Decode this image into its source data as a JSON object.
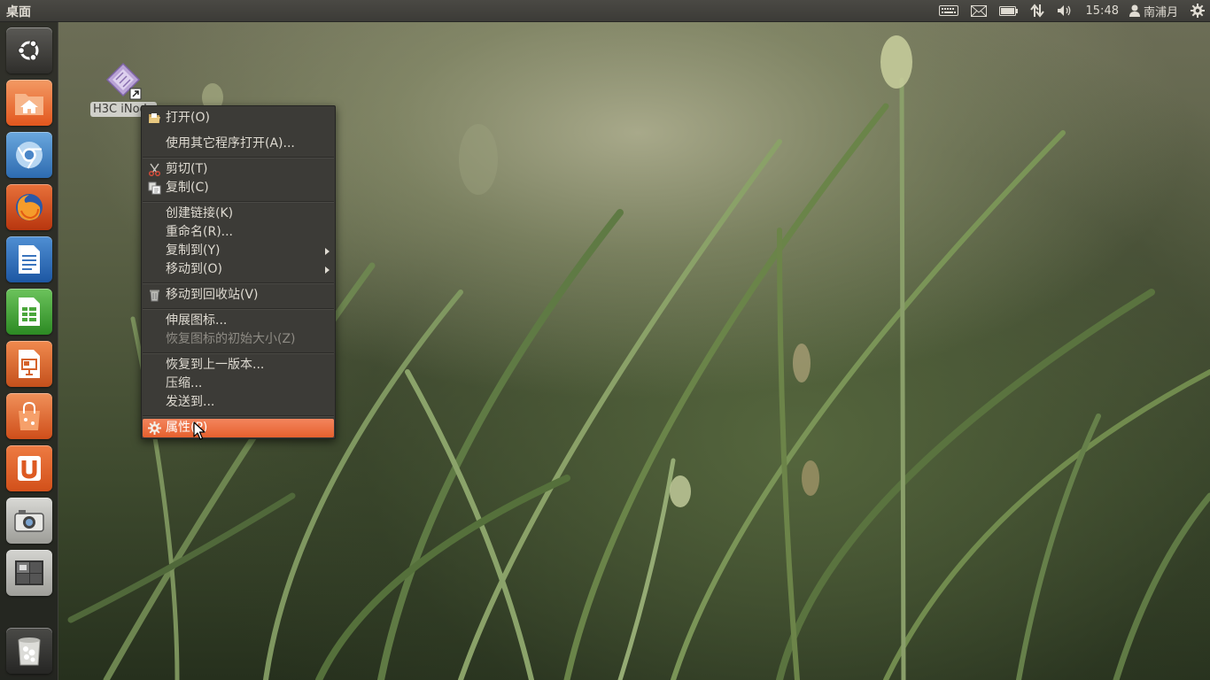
{
  "panel": {
    "title": "桌面",
    "clock": "15:48",
    "user": "南浦月"
  },
  "desktop_icon": {
    "label": "H3C iNode"
  },
  "launcher": {
    "items": [
      "dash-home",
      "home-folder",
      "chromium",
      "firefox",
      "libreoffice-writer",
      "libreoffice-calc",
      "libreoffice-impress",
      "software-center",
      "ubuntu-one",
      "cheese-camera",
      "workspace-switcher",
      "trash"
    ]
  },
  "context_menu": {
    "open": "打开(O)",
    "open_with": "使用其它程序打开(A)...",
    "cut": "剪切(T)",
    "copy": "复制(C)",
    "make_link": "创建链接(K)",
    "rename": "重命名(R)...",
    "copy_to": "复制到(Y)",
    "move_to": "移动到(O)",
    "move_to_trash": "移动到回收站(V)",
    "stretch_icon": "伸展图标...",
    "restore_icon_size": "恢复图标的初始大小(Z)",
    "revert_version": "恢复到上一版本...",
    "compress": "压缩...",
    "send_to": "发送到...",
    "properties": "属性(P)"
  },
  "colors": {
    "panel_bg": "#3c3b37",
    "menu_bg": "#3c3b37",
    "highlight": "#f07746",
    "text": "#dfdbd2"
  }
}
